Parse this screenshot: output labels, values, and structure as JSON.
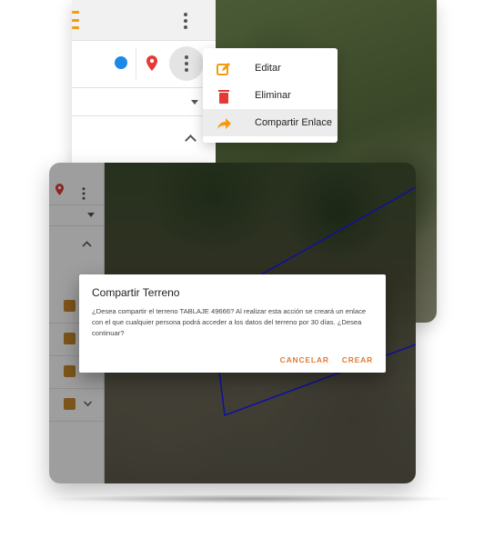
{
  "context_menu": {
    "items": [
      {
        "label": "Editar",
        "icon": "edit-icon"
      },
      {
        "label": "Eliminar",
        "icon": "trash-icon"
      },
      {
        "label": "Compartir Enlace",
        "icon": "share-icon"
      }
    ]
  },
  "dialog": {
    "title": "Compartir Terreno",
    "message": "¿Desea compartir el terreno TABLAJE 49666? Al realizar esta acción se creará un enlace con el que cualquier persona podrá acceder a los datos del terreno por 30 días. ¿Desea continuar?",
    "cancel_label": "CANCELAR",
    "confirm_label": "CREAR"
  },
  "colors": {
    "accent_orange": "#f39c12",
    "delete_red": "#e53935",
    "pin_red": "#e53935",
    "blue_dot": "#1e88e5",
    "plot_line": "#1a1aff",
    "dialog_button": "#e07b39"
  },
  "icons": {
    "hamburger": "hamburger-icon",
    "more": "more-vert-icon",
    "pin": "map-pin-icon",
    "blue": "location-dot-icon",
    "dropdown": "caret-down-icon",
    "collapse": "chevron-up-icon"
  }
}
